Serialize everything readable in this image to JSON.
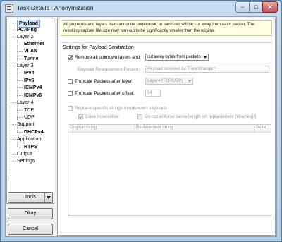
{
  "window": {
    "title": "Task Details - Anonymization",
    "min_glyph": "–",
    "max_glyph": "□",
    "close_glyph": "✕"
  },
  "nav": {
    "items": [
      {
        "label": "Payload",
        "bold": true,
        "selected": true
      },
      {
        "label": "PCAPng",
        "bold": true
      },
      {
        "label": "Layer 2"
      },
      {
        "label": "Ethernet",
        "bold": true
      },
      {
        "label": "VLAN",
        "bold": true
      },
      {
        "label": "Tunnel",
        "bold": true
      },
      {
        "label": "Layer 3"
      },
      {
        "label": "IPv4",
        "bold": true
      },
      {
        "label": "IPv6",
        "bold": true
      },
      {
        "label": "ICMPv4",
        "bold": true
      },
      {
        "label": "ICMPv6",
        "bold": true
      },
      {
        "label": "Layer 4"
      },
      {
        "label": "TCP"
      },
      {
        "label": "UDP"
      },
      {
        "label": "Support"
      },
      {
        "label": "DHCPv4",
        "bold": true
      },
      {
        "label": "Application"
      },
      {
        "label": "RTPS",
        "bold": true
      },
      {
        "label": "Output"
      },
      {
        "label": "Settings"
      }
    ]
  },
  "buttons": {
    "tools": "Tools",
    "okay": "Okay",
    "cancel": "Cancel"
  },
  "info_text": "All protocols and layers that cannot be understood or sanitized will be cut away from each packet. The resulting capture file size may turn out to be significantly smaller than the original.",
  "settings": {
    "section_title": "Settings for Payload Sanitization",
    "remove_unknown": {
      "label": "Remove all unknown layers and",
      "checked": true,
      "mode": "cut away bytes from packets"
    },
    "replacement_pattern": {
      "label": "Payload Replacement Pattern:",
      "value": "Payload removed by TraceWrangler!"
    },
    "truncate_layer": {
      "label": "Truncate Packets after layer:",
      "checked": false,
      "value": "Layer4 (TCP/UDP)"
    },
    "truncate_offset": {
      "label": "Truncate Packets after offset:",
      "checked": false,
      "value": "54"
    },
    "replace_strings": {
      "label": "Replace specific strings in unknown payloads",
      "checked": false
    },
    "case_insensitive": {
      "label": "Case Insensitive",
      "checked": true
    },
    "no_enforce_length": {
      "label": "Do not enforce same length on replacement (Warning!)",
      "checked": false
    }
  },
  "grid": {
    "columns": [
      "Original String",
      "Replacement String",
      "Delta"
    ]
  }
}
